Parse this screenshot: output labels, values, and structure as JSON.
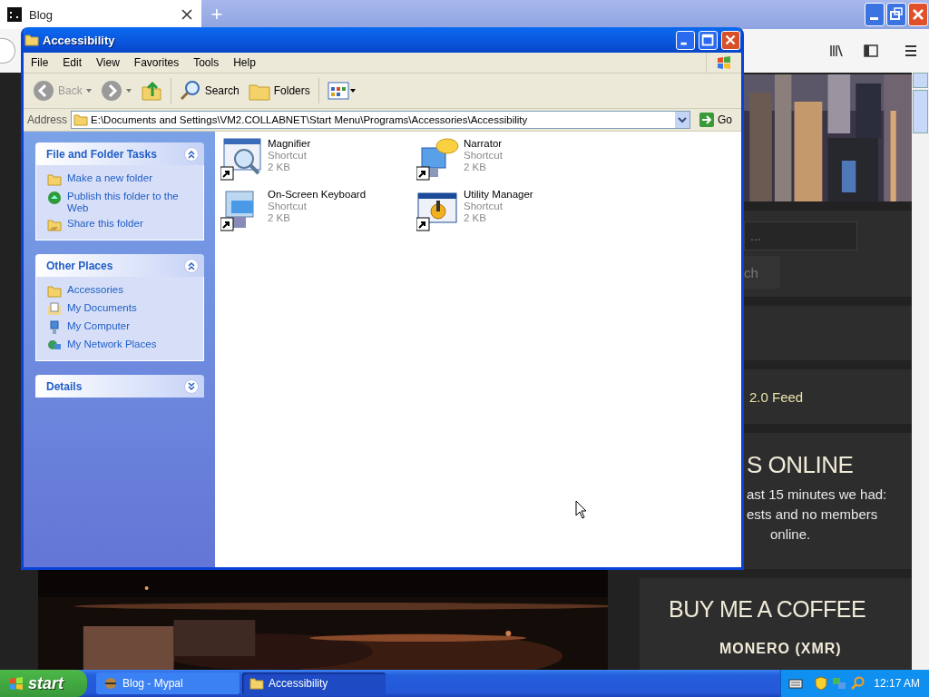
{
  "browser": {
    "tabs": [
      {
        "label": "Blog",
        "selected": true
      }
    ],
    "new_tab": "+",
    "website": {
      "search_placeholder": "...",
      "search_button": "ch",
      "feed_link": "2.0 Feed",
      "online_title": "S ONLINE",
      "online_lines": [
        "ast 15 minutes we had:",
        "ests and no members",
        "online."
      ],
      "coffee_title": "BUY ME A COFFEE",
      "coffee_subtitle": "MONERO (XMR)"
    }
  },
  "explorer": {
    "title": "Accessibility",
    "menu": [
      "File",
      "Edit",
      "View",
      "Favorites",
      "Tools",
      "Help"
    ],
    "toolbar": [
      {
        "kind": "back",
        "label": "Back",
        "disabled": true
      },
      {
        "kind": "forward",
        "disabled": true
      },
      {
        "kind": "up",
        "disabled": false
      },
      {
        "kind": "search",
        "label": "Search",
        "disabled": false
      },
      {
        "kind": "folders",
        "label": "Folders",
        "disabled": false
      },
      {
        "kind": "views",
        "disabled": false
      }
    ],
    "address": {
      "label": "Address",
      "value": "E:\\Documents and Settings\\VM2.COLLABNET\\Start Menu\\Programs\\Accessories\\Accessibility",
      "go": "Go"
    },
    "task_panes": [
      {
        "title": "File and Folder Tasks",
        "expanded": true,
        "items": [
          "Make a new folder",
          "Publish this folder to the Web",
          "Share this folder"
        ]
      },
      {
        "title": "Other Places",
        "expanded": true,
        "items": [
          "Accessories",
          "My Documents",
          "My Computer",
          "My Network Places"
        ]
      },
      {
        "title": "Details",
        "expanded": false
      }
    ],
    "files": [
      {
        "name": "Magnifier",
        "type": "Shortcut",
        "size": "2 KB"
      },
      {
        "name": "Narrator",
        "type": "Shortcut",
        "size": "2 KB"
      },
      {
        "name": "On-Screen Keyboard",
        "type": "Shortcut",
        "size": "2 KB"
      },
      {
        "name": "Utility Manager",
        "type": "Shortcut",
        "size": "2 KB"
      }
    ]
  },
  "taskbar": {
    "start": "start",
    "tasks": [
      {
        "label": "Blog - Mypal",
        "selected": false
      },
      {
        "label": "Accessibility",
        "selected": true
      }
    ],
    "clock": "12:17 AM"
  }
}
